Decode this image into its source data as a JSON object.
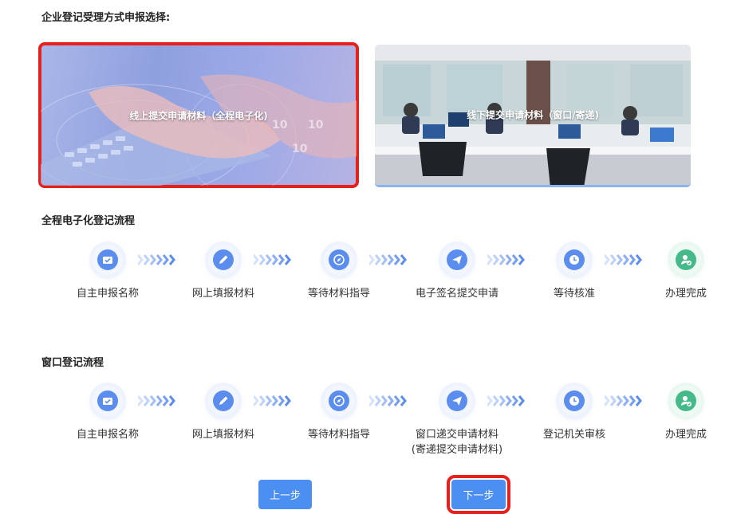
{
  "heading": "企业登记受理方式申报选择:",
  "methods": {
    "online": {
      "label": "线上提交申请材料（全程电子化)",
      "selected": true
    },
    "offline": {
      "label": "线下提交申请材料（窗口/寄递)",
      "selected": false
    }
  },
  "electronic_flow": {
    "title": "全程电子化登记流程",
    "steps": [
      {
        "label": "自主申报名称",
        "icon": "folder-check-icon"
      },
      {
        "label": "网上填报材料",
        "icon": "pencil-icon"
      },
      {
        "label": "等待材料指导",
        "icon": "compass-icon"
      },
      {
        "label": "电子签名提交申请",
        "icon": "paper-plane-icon"
      },
      {
        "label": "等待核准",
        "icon": "clock-icon"
      },
      {
        "label": "办理完成",
        "icon": "user-check-icon"
      }
    ]
  },
  "window_flow": {
    "title": "窗口登记流程",
    "steps": [
      {
        "label": "自主申报名称",
        "icon": "folder-check-icon"
      },
      {
        "label": "网上填报材料",
        "icon": "pencil-icon"
      },
      {
        "label": "等待材料指导",
        "icon": "compass-icon"
      },
      {
        "label": "窗口递交申请材料",
        "sublabel": "(寄递提交申请材料)",
        "icon": "paper-plane-icon"
      },
      {
        "label": "登记机关审核",
        "icon": "clock-icon"
      },
      {
        "label": "办理完成",
        "icon": "user-check-icon"
      }
    ]
  },
  "buttons": {
    "prev": "上一步",
    "next": "下一步"
  },
  "colors": {
    "accent": "#4b8ff2",
    "highlight": "#e8201b",
    "complete": "#46b98a"
  }
}
